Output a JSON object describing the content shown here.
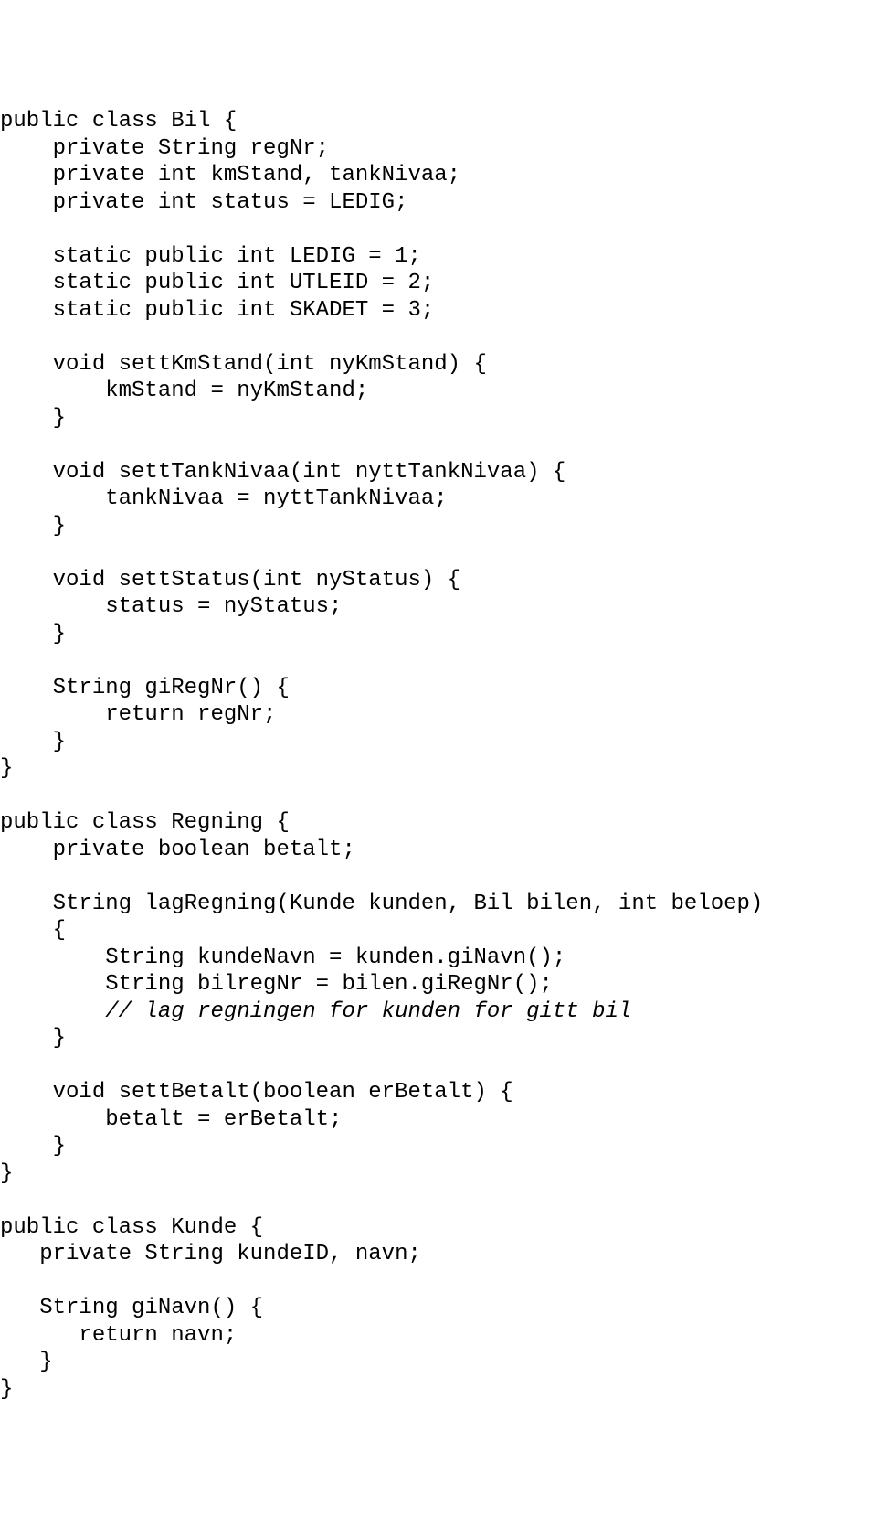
{
  "code": {
    "lines": [
      "public class Bil {",
      "    private String regNr;",
      "    private int kmStand, tankNivaa;",
      "    private int status = LEDIG;",
      "",
      "    static public int LEDIG = 1;",
      "    static public int UTLEID = 2;",
      "    static public int SKADET = 3;",
      "",
      "    void settKmStand(int nyKmStand) {",
      "        kmStand = nyKmStand;",
      "    }",
      "",
      "    void settTankNivaa(int nyttTankNivaa) {",
      "        tankNivaa = nyttTankNivaa;",
      "    }",
      "",
      "    void settStatus(int nyStatus) {",
      "        status = nyStatus;",
      "    }",
      "",
      "    String giRegNr() {",
      "        return regNr;",
      "    }",
      "}",
      "",
      "public class Regning {",
      "    private boolean betalt;",
      "",
      "    String lagRegning(Kunde kunden, Bil bilen, int beloep)",
      "    {",
      "        String kundeNavn = kunden.giNavn();",
      "        String bilregNr = bilen.giRegNr();"
    ],
    "comment_line": "        // lag regningen for kunden for gitt bil",
    "lines_after": [
      "    }",
      "",
      "    void settBetalt(boolean erBetalt) {",
      "        betalt = erBetalt;",
      "    }",
      "}",
      "",
      "public class Kunde {",
      "   private String kundeID, navn;",
      "",
      "   String giNavn() {",
      "      return navn;",
      "   }",
      "}"
    ]
  }
}
